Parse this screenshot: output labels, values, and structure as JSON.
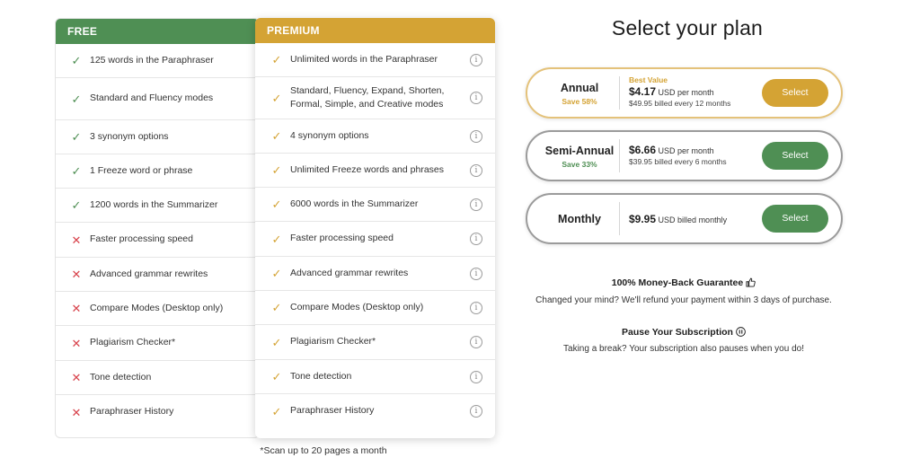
{
  "free": {
    "header": "FREE",
    "rows": [
      {
        "text": "125 words in the Paraphraser",
        "included": true
      },
      {
        "text": "Standard and Fluency modes",
        "included": true
      },
      {
        "text": "3 synonym options",
        "included": true
      },
      {
        "text": "1 Freeze word or phrase",
        "included": true
      },
      {
        "text": "1200 words in the Summarizer",
        "included": true
      },
      {
        "text": "Faster processing speed",
        "included": false
      },
      {
        "text": "Advanced grammar rewrites",
        "included": false
      },
      {
        "text": "Compare Modes (Desktop only)",
        "included": false
      },
      {
        "text": "Plagiarism Checker*",
        "included": false
      },
      {
        "text": "Tone detection",
        "included": false
      },
      {
        "text": "Paraphraser History",
        "included": false
      }
    ]
  },
  "premium": {
    "header": "PREMIUM",
    "rows": [
      {
        "text": "Unlimited words in the Paraphraser"
      },
      {
        "text": "Standard, Fluency, Expand, Shorten, Formal, Simple, and Creative modes"
      },
      {
        "text": "4 synonym options"
      },
      {
        "text": "Unlimited Freeze words and phrases"
      },
      {
        "text": "6000 words in the Summarizer"
      },
      {
        "text": "Faster processing speed"
      },
      {
        "text": "Advanced grammar rewrites"
      },
      {
        "text": "Compare Modes (Desktop only)"
      },
      {
        "text": "Plagiarism Checker*"
      },
      {
        "text": "Tone detection"
      },
      {
        "text": "Paraphraser History"
      }
    ]
  },
  "footnote": "*Scan up to 20 pages a month",
  "plans": {
    "title": "Select your plan",
    "annual": {
      "name": "Annual",
      "save": "Save 58%",
      "badge": "Best Value",
      "price": "$4.17",
      "unit": "USD per month",
      "billed": "$49.95 billed every 12 months",
      "button": "Select"
    },
    "semi": {
      "name": "Semi-Annual",
      "save": "Save 33%",
      "price": "$6.66",
      "unit": "USD per month",
      "billed": "$39.95 billed every 6 months",
      "button": "Select"
    },
    "monthly": {
      "name": "Monthly",
      "price": "$9.95",
      "unit": "USD billed monthly",
      "button": "Select"
    }
  },
  "guarantee": {
    "title": "100% Money-Back Guarantee",
    "text": "Changed your mind? We'll refund your payment within 3 days of purchase."
  },
  "pause": {
    "title": "Pause Your Subscription",
    "text": "Taking a break? Your subscription also pauses when you do!"
  },
  "colors": {
    "green": "#4f8f54",
    "gold": "#d4a334",
    "red": "#d8434c"
  },
  "icons": {
    "included": "check-icon",
    "excluded": "x-icon",
    "info": "info-icon",
    "guarantee": "thumbs-up-icon",
    "pause": "pause-icon"
  }
}
